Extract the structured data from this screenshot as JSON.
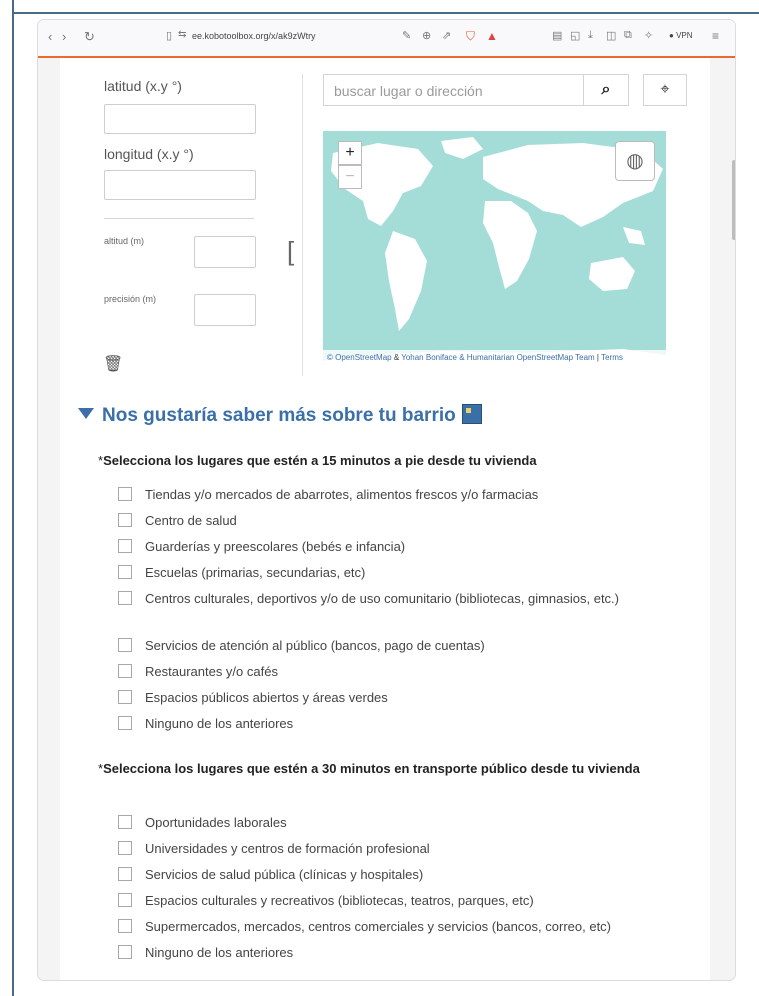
{
  "browser": {
    "url": "ee.kobotoolbox.org/x/ak9zWtry",
    "vpn_label": "VPN"
  },
  "geo": {
    "latitude_label": "latitud (x.y °)",
    "longitude_label": "longitud (x.y °)",
    "altitude_label": "altitud (m)",
    "precision_label": "precisión (m)",
    "search_placeholder": "buscar lugar o dirección",
    "zoom_in": "+",
    "zoom_out": "−",
    "attribution_1": "© OpenStreetMap",
    "attribution_amp": " & ",
    "attribution_2": "Yohan Boniface & Humanitarian OpenStreetMap Team",
    "attribution_sep": " | ",
    "attribution_3": "Terms"
  },
  "group": {
    "title": "Nos gustaría saber más sobre tu barrio"
  },
  "q1": {
    "required_mark": "*",
    "label": "Selecciona los lugares que estén a 15 minutos a pie desde tu vivienda",
    "options": [
      "Tiendas y/o mercados de abarrotes, alimentos frescos y/o farmacias",
      "Centro de salud",
      "Guarderías y preescolares (bebés e infancia)",
      "Escuelas (primarias, secundarias, etc)",
      "Centros culturales, deportivos y/o de uso comunitario (bibliotecas, gimnasios, etc.)",
      "Servicios de atención al público (bancos, pago de cuentas)",
      "Restaurantes y/o cafés",
      "Espacios públicos abiertos y áreas verdes",
      "Ninguno de los anteriores"
    ]
  },
  "q2": {
    "required_mark": "*",
    "label": "Selecciona los lugares que estén a 30 minutos en transporte público desde tu vivienda",
    "options": [
      "Oportunidades laborales",
      "Universidades y centros de formación profesional",
      "Servicios de salud pública (clínicas y hospitales)",
      "Espacios culturales y recreativos (bibliotecas, teatros, parques, etc)",
      "Supermercados, mercados, centros comerciales y servicios (bancos, correo, etc)",
      "Ninguno de los anteriores"
    ]
  },
  "icons": {
    "search": "search-icon",
    "locate": "crosshair-icon",
    "layers": "globe-icon",
    "trash": "trash-icon",
    "collapse": "triangle-down-icon",
    "group": "building-icon"
  },
  "colors": {
    "accent": "#3b6fa8",
    "toolbar_accent": "#e86a2c",
    "map_water": "#a4ddd8",
    "map_land": "#ffffff"
  }
}
